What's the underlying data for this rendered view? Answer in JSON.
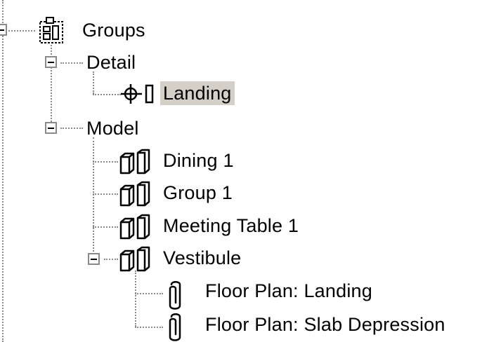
{
  "tree": {
    "root": {
      "label": "Groups",
      "icon": "groups-icon"
    },
    "detail": {
      "label": "Detail",
      "children": [
        {
          "label": "Landing",
          "icon": "detail-group-icon",
          "selected": true
        }
      ]
    },
    "model": {
      "label": "Model",
      "children": [
        {
          "label": "Dining 1",
          "icon": "model-group-icon"
        },
        {
          "label": "Group 1",
          "icon": "model-group-icon"
        },
        {
          "label": "Meeting Table 1",
          "icon": "model-group-icon"
        },
        {
          "label": "Vestibule",
          "icon": "model-group-icon",
          "children": [
            {
              "label": "Floor Plan: Landing",
              "icon": "paperclip-icon"
            },
            {
              "label": "Floor Plan: Slab Depression",
              "icon": "paperclip-icon"
            }
          ]
        }
      ]
    }
  }
}
